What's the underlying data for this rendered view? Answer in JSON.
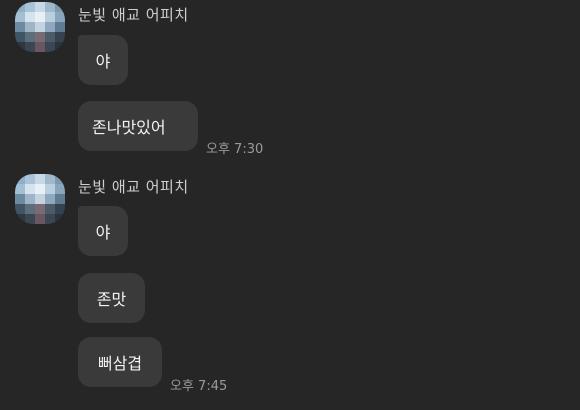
{
  "groups": [
    {
      "sender": "눈빛 애교 어피치",
      "messages": [
        {
          "text": "야"
        },
        {
          "text": "존나맛있어"
        }
      ],
      "time": "오후 7:30"
    },
    {
      "sender": "눈빛 애교 어피치",
      "messages": [
        {
          "text": "야"
        },
        {
          "text": "존맛"
        },
        {
          "text": "뻐삼겹"
        }
      ],
      "time": "오후 7:45"
    }
  ],
  "avatar_colors": [
    "#8fb0c8",
    "#a9c4d8",
    "#c7d8e6",
    "#9fb8cc",
    "#7d99b0",
    "#a3bfd4",
    "#d5e3ee",
    "#e8f0f6",
    "#b8cfe0",
    "#8aa6bd",
    "#6d8aa3",
    "#9fb5c7",
    "#c3d3e0",
    "#8ea9bf",
    "#5f7b92",
    "#3f5566",
    "#5a6e7d",
    "#7a6a73",
    "#4b5b67",
    "#34434f",
    "#2d3842",
    "#3b4650",
    "#6a5660",
    "#3a4752",
    "#2a343d"
  ]
}
